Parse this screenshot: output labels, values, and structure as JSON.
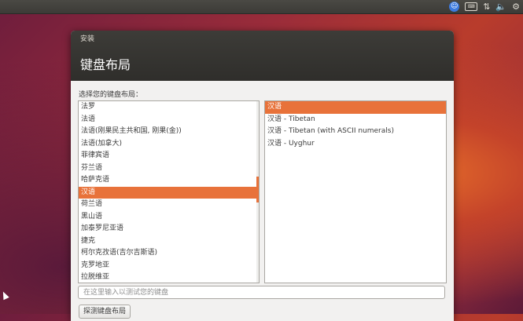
{
  "top_panel": {
    "icons": [
      "accessibility-icon",
      "keyboard-icon",
      "network-icon",
      "volume-icon",
      "settings-gear-icon"
    ]
  },
  "window": {
    "title": "安装",
    "heading": "键盘布局",
    "section_label": "选择您的键盘布局：",
    "layouts": [
      "法罗",
      "法语",
      "法语(刚果民主共和国, 刚果(金))",
      "法语(加拿大)",
      "菲律宾语",
      "芬兰语",
      "哈萨克语",
      "汉语",
      "荷兰语",
      "黑山语",
      "加泰罗尼亚语",
      "捷克",
      "柯尔克孜语(吉尔吉斯语)",
      "克罗地亚",
      "拉脱维亚"
    ],
    "selected_layout_index": 7,
    "variants": [
      "汉语",
      "汉语 - Tibetan",
      "汉语 - Tibetan (with ASCII numerals)",
      "汉语 - Uyghur"
    ],
    "selected_variant_index": 0,
    "test_input_placeholder": "在这里输入以测试您的键盘",
    "detect_button_label": "探测键盘布局"
  },
  "colors": {
    "selection": "#e8723a",
    "header": "#3c3b37"
  }
}
